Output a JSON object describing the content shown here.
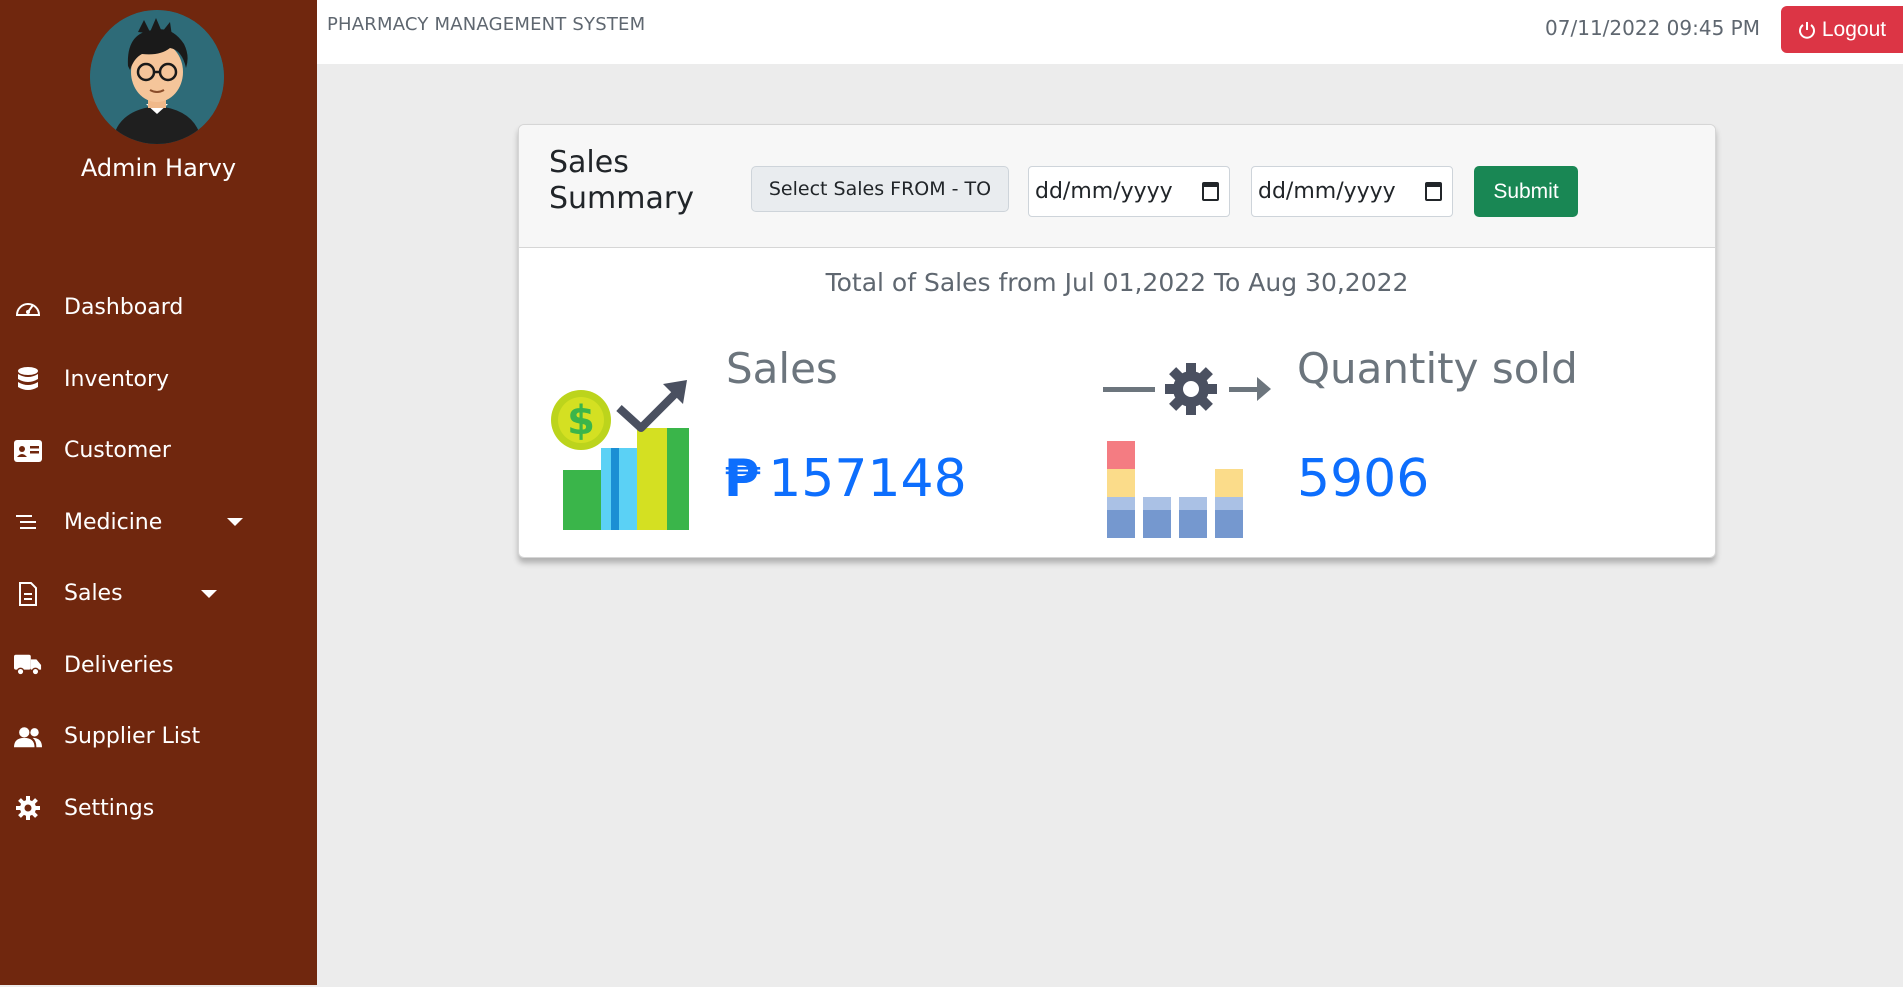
{
  "sidebar": {
    "user_name": "Admin Harvy",
    "items": [
      {
        "label": "Dashboard",
        "icon": "speedometer-icon"
      },
      {
        "label": "Inventory",
        "icon": "database-icon"
      },
      {
        "label": "Customer",
        "icon": "id-card-icon"
      },
      {
        "label": "Medicine",
        "icon": "list-icon",
        "dropdown": true
      },
      {
        "label": "Sales",
        "icon": "document-icon",
        "dropdown": true
      },
      {
        "label": "Deliveries",
        "icon": "truck-icon"
      },
      {
        "label": "Supplier List",
        "icon": "users-icon"
      },
      {
        "label": "Settings",
        "icon": "gear-icon"
      }
    ]
  },
  "header": {
    "app_title": "PHARMACY MANAGEMENT SYSTEM",
    "datetime": "07/11/2022 09:45 PM",
    "logout_label": "Logout"
  },
  "summary": {
    "title": "Sales Summary",
    "range_label": "Select Sales FROM - TO",
    "from_placeholder": "dd/mm/yyyy",
    "to_placeholder": "dd/mm/yyyy",
    "submit_label": "Submit",
    "total_line": "Total of Sales from Jul 01,2022 To Aug 30,2022",
    "sales_label": "Sales",
    "currency_symbol": "₱",
    "sales_value": "157148",
    "quantity_label": "Quantity sold",
    "quantity_value": "5906"
  },
  "colors": {
    "sidebar_bg": "#70270e",
    "accent_blue": "#0d6efd",
    "logout_red": "#dc3545",
    "submit_green": "#198754"
  }
}
